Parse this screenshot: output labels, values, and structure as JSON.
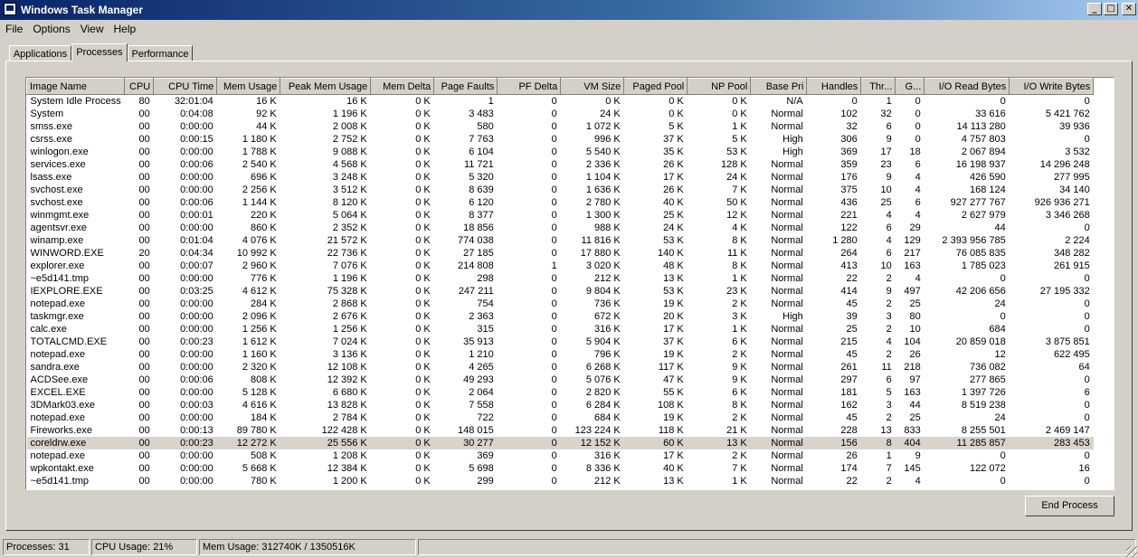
{
  "window": {
    "title": "Windows Task Manager",
    "minimize": "_",
    "maximize": "□",
    "close": "✕"
  },
  "menu": [
    "File",
    "Options",
    "View",
    "Help"
  ],
  "tabs": [
    "Applications",
    "Processes",
    "Performance"
  ],
  "active_tab": "Processes",
  "columns": [
    "Image Name",
    "CPU",
    "CPU Time",
    "Mem Usage",
    "Peak Mem Usage",
    "Mem Delta",
    "Page Faults",
    "PF Delta",
    "VM Size",
    "Paged Pool",
    "NP Pool",
    "Base Pri",
    "Handles",
    "Thr...",
    "G...",
    "I/O Read Bytes",
    "I/O Write Bytes"
  ],
  "processes": [
    [
      "System Idle Process",
      "80",
      "32:01:04",
      "16 K",
      "16 K",
      "0 K",
      "1",
      "0",
      "0 K",
      "0 K",
      "0 K",
      "N/A",
      "0",
      "1",
      "0",
      "0",
      "0"
    ],
    [
      "System",
      "00",
      "0:04:08",
      "92 K",
      "1 196 K",
      "0 K",
      "3 483",
      "0",
      "24 K",
      "0 K",
      "0 K",
      "Normal",
      "102",
      "32",
      "0",
      "33 616",
      "5 421 762"
    ],
    [
      "smss.exe",
      "00",
      "0:00:00",
      "44 K",
      "2 008 K",
      "0 K",
      "580",
      "0",
      "1 072 K",
      "5 K",
      "1 K",
      "Normal",
      "32",
      "6",
      "0",
      "14 113 280",
      "39 936"
    ],
    [
      "csrss.exe",
      "00",
      "0:00:15",
      "1 180 K",
      "2 752 K",
      "0 K",
      "7 763",
      "0",
      "996 K",
      "37 K",
      "5 K",
      "High",
      "306",
      "9",
      "0",
      "4 757 803",
      "0"
    ],
    [
      "winlogon.exe",
      "00",
      "0:00:00",
      "1 788 K",
      "9 088 K",
      "0 K",
      "6 104",
      "0",
      "5 540 K",
      "35 K",
      "53 K",
      "High",
      "369",
      "17",
      "18",
      "2 067 894",
      "3 532"
    ],
    [
      "services.exe",
      "00",
      "0:00:06",
      "2 540 K",
      "4 568 K",
      "0 K",
      "11 721",
      "0",
      "2 336 K",
      "26 K",
      "128 K",
      "Normal",
      "359",
      "23",
      "6",
      "16 198 937",
      "14 296 248"
    ],
    [
      "lsass.exe",
      "00",
      "0:00:00",
      "696 K",
      "3 248 K",
      "0 K",
      "5 320",
      "0",
      "1 104 K",
      "17 K",
      "24 K",
      "Normal",
      "176",
      "9",
      "4",
      "426 590",
      "277 995"
    ],
    [
      "svchost.exe",
      "00",
      "0:00:00",
      "2 256 K",
      "3 512 K",
      "0 K",
      "8 639",
      "0",
      "1 636 K",
      "26 K",
      "7 K",
      "Normal",
      "375",
      "10",
      "4",
      "168 124",
      "34 140"
    ],
    [
      "svchost.exe",
      "00",
      "0:00:06",
      "1 144 K",
      "8 120 K",
      "0 K",
      "6 120",
      "0",
      "2 780 K",
      "40 K",
      "50 K",
      "Normal",
      "436",
      "25",
      "6",
      "927 277 767",
      "926 936 271"
    ],
    [
      "winmgmt.exe",
      "00",
      "0:00:01",
      "220 K",
      "5 064 K",
      "0 K",
      "8 377",
      "0",
      "1 300 K",
      "25 K",
      "12 K",
      "Normal",
      "221",
      "4",
      "4",
      "2 627 979",
      "3 346 268"
    ],
    [
      "agentsvr.exe",
      "00",
      "0:00:00",
      "860 K",
      "2 352 K",
      "0 K",
      "18 856",
      "0",
      "988 K",
      "24 K",
      "4 K",
      "Normal",
      "122",
      "6",
      "29",
      "44",
      "0"
    ],
    [
      "winamp.exe",
      "00",
      "0:01:04",
      "4 076 K",
      "21 572 K",
      "0 K",
      "774 038",
      "0",
      "11 816 K",
      "53 K",
      "8 K",
      "Normal",
      "1 280",
      "4",
      "129",
      "2 393 956 785",
      "2 224"
    ],
    [
      "WINWORD.EXE",
      "20",
      "0:04:34",
      "10 992 K",
      "22 736 K",
      "0 K",
      "27 185",
      "0",
      "17 880 K",
      "140 K",
      "11 K",
      "Normal",
      "264",
      "6",
      "217",
      "76 085 835",
      "348 282"
    ],
    [
      "explorer.exe",
      "00",
      "0:00:07",
      "2 960 K",
      "7 076 K",
      "0 K",
      "214 808",
      "1",
      "3 020 K",
      "48 K",
      "8 K",
      "Normal",
      "413",
      "10",
      "163",
      "1 785 023",
      "261 915"
    ],
    [
      "~e5d141.tmp",
      "00",
      "0:00:00",
      "776 K",
      "1 196 K",
      "0 K",
      "298",
      "0",
      "212 K",
      "13 K",
      "1 K",
      "Normal",
      "22",
      "2",
      "4",
      "0",
      "0"
    ],
    [
      "IEXPLORE.EXE",
      "00",
      "0:03:25",
      "4 612 K",
      "75 328 K",
      "0 K",
      "247 211",
      "0",
      "9 804 K",
      "53 K",
      "23 K",
      "Normal",
      "414",
      "9",
      "497",
      "42 206 656",
      "27 195 332"
    ],
    [
      "notepad.exe",
      "00",
      "0:00:00",
      "284 K",
      "2 868 K",
      "0 K",
      "754",
      "0",
      "736 K",
      "19 K",
      "2 K",
      "Normal",
      "45",
      "2",
      "25",
      "24",
      "0"
    ],
    [
      "taskmgr.exe",
      "00",
      "0:00:00",
      "2 096 K",
      "2 676 K",
      "0 K",
      "2 363",
      "0",
      "672 K",
      "20 K",
      "3 K",
      "High",
      "39",
      "3",
      "80",
      "0",
      "0"
    ],
    [
      "calc.exe",
      "00",
      "0:00:00",
      "1 256 K",
      "1 256 K",
      "0 K",
      "315",
      "0",
      "316 K",
      "17 K",
      "1 K",
      "Normal",
      "25",
      "2",
      "10",
      "684",
      "0"
    ],
    [
      "TOTALCMD.EXE",
      "00",
      "0:00:23",
      "1 612 K",
      "7 024 K",
      "0 K",
      "35 913",
      "0",
      "5 904 K",
      "37 K",
      "6 K",
      "Normal",
      "215",
      "4",
      "104",
      "20 859 018",
      "3 875 851"
    ],
    [
      "notepad.exe",
      "00",
      "0:00:00",
      "1 160 K",
      "3 136 K",
      "0 K",
      "1 210",
      "0",
      "796 K",
      "19 K",
      "2 K",
      "Normal",
      "45",
      "2",
      "26",
      "12",
      "622 495"
    ],
    [
      "sandra.exe",
      "00",
      "0:00:00",
      "2 320 K",
      "12 108 K",
      "0 K",
      "4 265",
      "0",
      "6 268 K",
      "117 K",
      "9 K",
      "Normal",
      "261",
      "11",
      "218",
      "736 082",
      "64"
    ],
    [
      "ACDSee.exe",
      "00",
      "0:00:06",
      "808 K",
      "12 392 K",
      "0 K",
      "49 293",
      "0",
      "5 076 K",
      "47 K",
      "9 K",
      "Normal",
      "297",
      "6",
      "97",
      "277 865",
      "0"
    ],
    [
      "EXCEL.EXE",
      "00",
      "0:00:00",
      "5 128 K",
      "6 680 K",
      "0 K",
      "2 064",
      "0",
      "2 820 K",
      "55 K",
      "6 K",
      "Normal",
      "181",
      "5",
      "163",
      "1 397 726",
      "6"
    ],
    [
      "3DMark03.exe",
      "00",
      "0:00:03",
      "4 616 K",
      "13 828 K",
      "0 K",
      "7 558",
      "0",
      "6 284 K",
      "108 K",
      "8 K",
      "Normal",
      "162",
      "3",
      "44",
      "8 519 238",
      "0"
    ],
    [
      "notepad.exe",
      "00",
      "0:00:00",
      "184 K",
      "2 784 K",
      "0 K",
      "722",
      "0",
      "684 K",
      "19 K",
      "2 K",
      "Normal",
      "45",
      "2",
      "25",
      "24",
      "0"
    ],
    [
      "Fireworks.exe",
      "00",
      "0:00:13",
      "89 780 K",
      "122 428 K",
      "0 K",
      "148 015",
      "0",
      "123 224 K",
      "118 K",
      "21 K",
      "Normal",
      "228",
      "13",
      "833",
      "8 255 501",
      "2 469 147"
    ],
    [
      "coreldrw.exe",
      "00",
      "0:00:23",
      "12 272 K",
      "25 556 K",
      "0 K",
      "30 277",
      "0",
      "12 152 K",
      "60 K",
      "13 K",
      "Normal",
      "156",
      "8",
      "404",
      "11 285 857",
      "283 453"
    ],
    [
      "notepad.exe",
      "00",
      "0:00:00",
      "508 K",
      "1 208 K",
      "0 K",
      "369",
      "0",
      "316 K",
      "17 K",
      "2 K",
      "Normal",
      "26",
      "1",
      "9",
      "0",
      "0"
    ],
    [
      "wpkontakt.exe",
      "00",
      "0:00:00",
      "5 668 K",
      "12 384 K",
      "0 K",
      "5 698",
      "0",
      "8 336 K",
      "40 K",
      "7 K",
      "Normal",
      "174",
      "7",
      "145",
      "122 072",
      "16"
    ],
    [
      "~e5d141.tmp",
      "00",
      "0:00:00",
      "780 K",
      "1 200 K",
      "0 K",
      "299",
      "0",
      "212 K",
      "13 K",
      "1 K",
      "Normal",
      "22",
      "2",
      "4",
      "0",
      "0"
    ]
  ],
  "selected_row": "coreldrw.exe",
  "end_process_label": "End Process",
  "status": {
    "processes": "Processes: 31",
    "cpu": "CPU Usage: 21%",
    "mem": "Mem Usage: 312740K / 1350516K"
  }
}
